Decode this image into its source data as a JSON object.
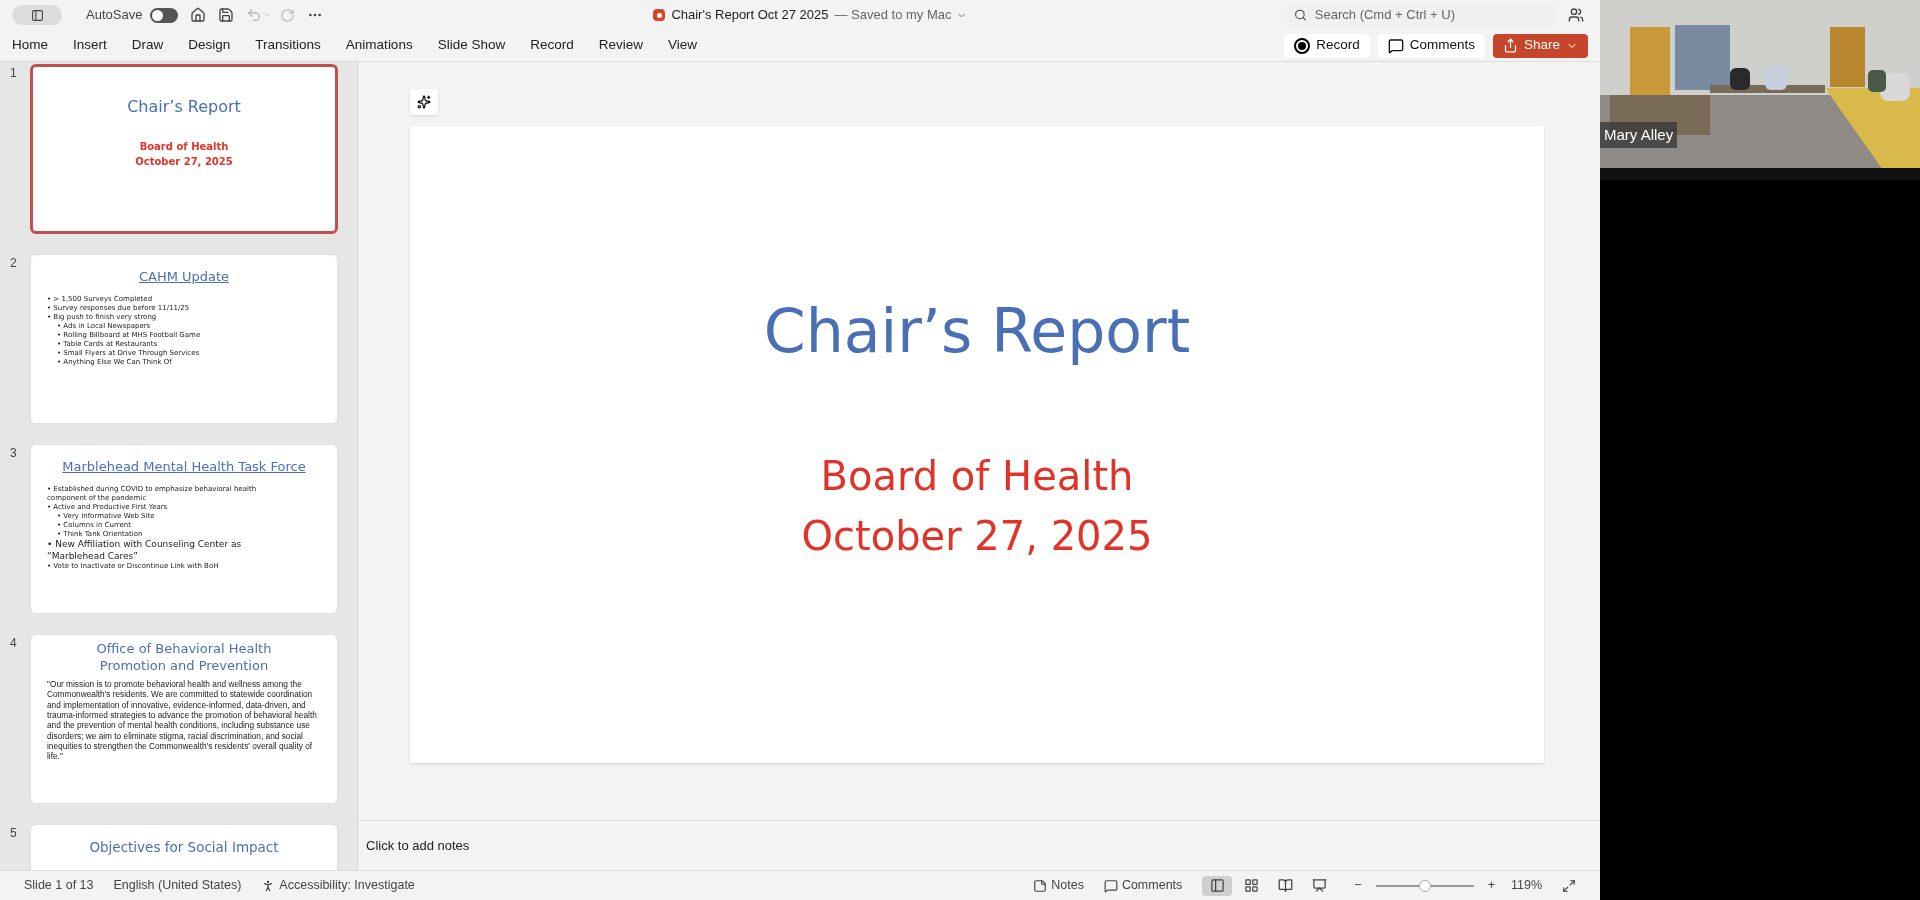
{
  "title_bar": {
    "autosave_label": "AutoSave",
    "autosave_on": false,
    "document_title": "Chair's Report Oct 27 2025",
    "save_status": "— Saved to my Mac",
    "search_placeholder": "Search (Cmd + Ctrl + U)"
  },
  "ribbon_tabs": [
    {
      "label": "Home"
    },
    {
      "label": "Insert"
    },
    {
      "label": "Draw"
    },
    {
      "label": "Design"
    },
    {
      "label": "Transitions"
    },
    {
      "label": "Animations"
    },
    {
      "label": "Slide Show"
    },
    {
      "label": "Record"
    },
    {
      "label": "Review"
    },
    {
      "label": "View"
    }
  ],
  "ribbon_buttons": [
    {
      "kind": "record",
      "label": "Record"
    },
    {
      "kind": "comments",
      "label": "Comments"
    },
    {
      "kind": "share",
      "label": "Share"
    }
  ],
  "thumbnails": [
    {
      "number": "1",
      "selected": true,
      "kind": "title",
      "title": "Chair’s Report",
      "subtitle_lines": [
        "Board of Health",
        "October 27, 2025"
      ]
    },
    {
      "number": "2",
      "selected": false,
      "kind": "bullets",
      "title": "CAHM Update",
      "bullets": [
        {
          "text": "• > 1,500 Surveys Completed"
        },
        {
          "text": "• Survey responses due before 11/11/25"
        },
        {
          "text": "• Big push to finish very strong",
          "children": [
            {
              "text": "• Ads in Local Newspapers"
            },
            {
              "text": "• Rolling Billboard at MHS Football Game"
            },
            {
              "text": "• Table Cards at Restaurants"
            },
            {
              "text": "• Small Flyers at Drive Through Services"
            },
            {
              "text": "• Anything Else We Can Think Of"
            }
          ]
        }
      ]
    },
    {
      "number": "3",
      "selected": false,
      "kind": "bullets",
      "title": "Marblehead Mental Health Task Force",
      "bullets": [
        {
          "text": "• Established during COVID to emphasize behavioral health component of the pandemic",
          "large": false
        },
        {
          "text": "• Active and Productive First Years",
          "large": false,
          "children": [
            {
              "text": "• Very Informative Web Site"
            },
            {
              "text": "• Columns in Current"
            },
            {
              "text": "• Think Tank Orientation"
            }
          ]
        },
        {
          "text": "• New Affiliation with Counseling Center as “Marblehead Cares”",
          "large": true
        },
        {
          "text": "• Vote to Inactivate or Discontinue Link with BoH",
          "large": false
        }
      ]
    },
    {
      "number": "4",
      "selected": false,
      "kind": "quote",
      "title": "Office of Behavioral Health Promotion and Prevention",
      "body": "\"Our mission is to promote behavioral health and wellness among the Commonwealth's residents. We are committed to statewide coordination and implementation of innovative, evidence-informed, data-driven, and trauma-informed strategies to advance the promotion of behavioral health and the prevention of mental health conditions, including substance use disorders; we aim to eliminate stigma, racial discrimination, and social inequities to strengthen the Commonwealth's residents' overall quality of life.\""
    },
    {
      "number": "5",
      "selected": false,
      "kind": "title_only",
      "title": "Objectives for Social Impact"
    }
  ],
  "slide": {
    "title": "Chair’s Report",
    "subtitle_lines": [
      "Board of Health",
      "October 27, 2025"
    ]
  },
  "notes_placeholder": "Click to add notes",
  "status_bar": {
    "slide_count": "Slide 1 of 13",
    "language": "English (United States)",
    "accessibility": "Accessibility: Investigate",
    "notes": "Notes",
    "comments": "Comments",
    "views": [
      {
        "kind": "normal",
        "selected": true
      },
      {
        "kind": "sorter",
        "selected": false
      },
      {
        "kind": "reading",
        "selected": false
      },
      {
        "kind": "presenter",
        "selected": false
      }
    ],
    "zoom_minus": "−",
    "zoom_plus": "+",
    "zoom": {
      "level": 0.5
    },
    "zoom_percent": "119%"
  },
  "video": {
    "name": "Mary Alley"
  }
}
